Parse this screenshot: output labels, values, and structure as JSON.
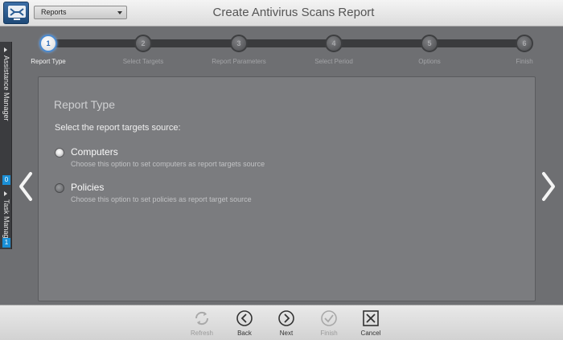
{
  "header": {
    "module_select": "Reports",
    "title": "Create Antivirus Scans Report"
  },
  "side_tabs": [
    {
      "label": "Assistance Manager",
      "count": "0"
    },
    {
      "label": "Task Manager",
      "count": "1"
    }
  ],
  "wizard": {
    "steps": [
      {
        "number": "1",
        "label": "Report Type",
        "active": true
      },
      {
        "number": "2",
        "label": "Select Targets",
        "active": false
      },
      {
        "number": "3",
        "label": "Report Parameters",
        "active": false
      },
      {
        "number": "4",
        "label": "Select Period",
        "active": false
      },
      {
        "number": "5",
        "label": "Options",
        "active": false
      },
      {
        "number": "6",
        "label": "Finish",
        "active": false
      }
    ]
  },
  "panel": {
    "title": "Report Type",
    "prompt": "Select the report targets source:",
    "options": [
      {
        "label": "Computers",
        "description": "Choose this option to set computers as report targets source",
        "selected": true
      },
      {
        "label": "Policies",
        "description": "Choose this option to set policies as report target source",
        "selected": false
      }
    ]
  },
  "toolbar": {
    "refresh": "Refresh",
    "back": "Back",
    "next": "Next",
    "finish": "Finish",
    "cancel": "Cancel"
  },
  "colors": {
    "accent": "#4a8ad0",
    "badge": "#1a8fd6",
    "panel_bg": "#7b7c7f",
    "page_bg": "#6e6f72"
  },
  "icons": [
    "app-logo-icon",
    "chevron-down-icon",
    "chevron-left-icon",
    "chevron-right-icon",
    "refresh-icon",
    "back-icon",
    "next-icon",
    "finish-check-icon",
    "cancel-x-icon"
  ]
}
